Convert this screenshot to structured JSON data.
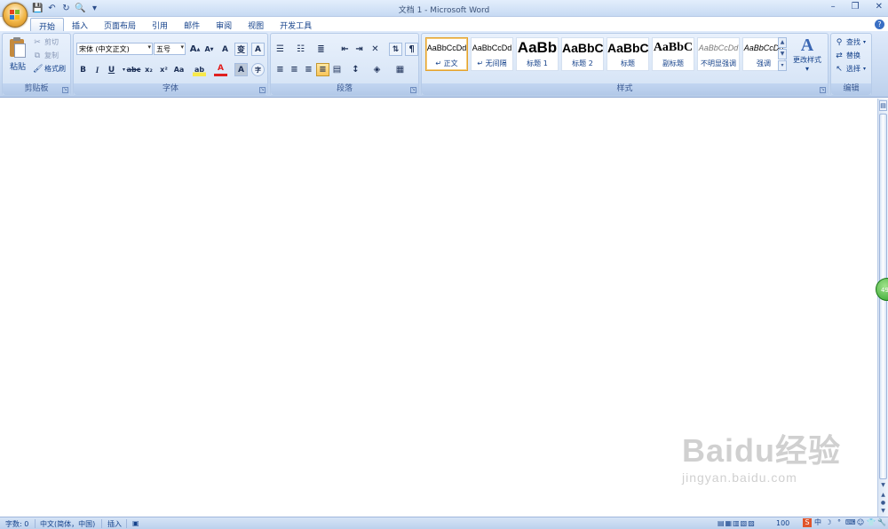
{
  "window": {
    "title": "文档 1 - Microsoft Word",
    "controls": [
      "–",
      "❐",
      "✕"
    ]
  },
  "qat": {
    "save": "💾",
    "undo": "↶",
    "redo": "↻",
    "preview": "🔍",
    "more": "▾"
  },
  "tabs": [
    "开始",
    "插入",
    "页面布局",
    "引用",
    "邮件",
    "审阅",
    "视图",
    "开发工具"
  ],
  "help": "?",
  "clipboard": {
    "paste": "粘贴",
    "cut": "剪切",
    "copy": "复制",
    "format_painter": "格式刷",
    "group_label": "剪贴板"
  },
  "font": {
    "font_name": "宋体 (中文正文)",
    "font_size": "五号",
    "grow": "A",
    "shrink": "A",
    "clear": "A",
    "phonetic": "变",
    "border": "A",
    "bold": "B",
    "italic": "I",
    "underline": "U",
    "strike": "abc",
    "subscript": "x₂",
    "superscript": "x²",
    "case": "Aa",
    "highlight": "ab",
    "font_color": "A",
    "shading": "A",
    "enclose": "字",
    "group_label": "字体"
  },
  "paragraph": {
    "group_label": "段落"
  },
  "styles": {
    "items": [
      {
        "sample": "AaBbCcDd",
        "name": "↵ 正文"
      },
      {
        "sample": "AaBbCcDd",
        "name": "↵ 无间隔"
      },
      {
        "sample": "AaBb",
        "name": "标题 1"
      },
      {
        "sample": "AaBbC",
        "name": "标题 2"
      },
      {
        "sample": "AaBbC",
        "name": "标题"
      },
      {
        "sample": "AaBbC",
        "name": "副标题"
      },
      {
        "sample": "AaBbCcDd",
        "name": "不明显强调"
      },
      {
        "sample": "AaBbCcDd",
        "name": "强调"
      }
    ],
    "change_styles": "更改样式",
    "group_label": "样式"
  },
  "editing": {
    "find": "查找",
    "replace": "替换",
    "select": "选择",
    "group_label": "编辑"
  },
  "status": {
    "word_count": "字数: 0",
    "language": "中文(简体，中国)",
    "insert_mode": "插入",
    "zoom": "100"
  },
  "side_badge": "49",
  "watermark": {
    "big": "Baidu经验",
    "small": "jingyan.baidu.com"
  },
  "colors": {
    "accent": "#15428b",
    "ribbon": "#c7d9f1",
    "highlight_yellow": "#f7e94a",
    "font_red": "#e02020"
  }
}
